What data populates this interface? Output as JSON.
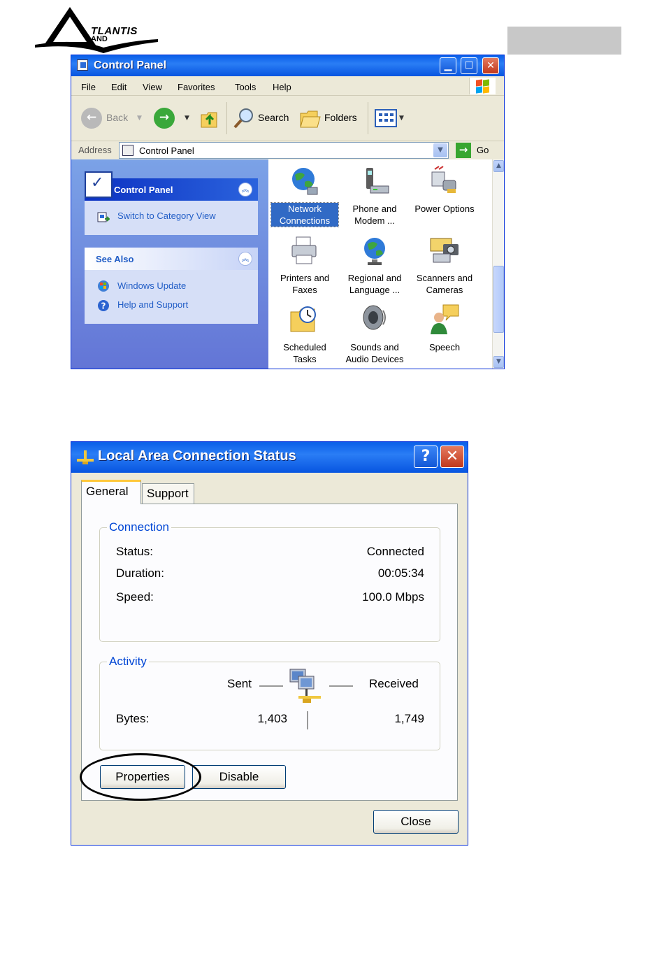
{
  "header": {
    "logo_text": "TLANTIS",
    "logo_sub": "AND"
  },
  "control_panel": {
    "title": "Control Panel",
    "menu": [
      "File",
      "Edit",
      "View",
      "Favorites",
      "Tools",
      "Help"
    ],
    "toolbar": {
      "back_label": "Back",
      "search_label": "Search",
      "folders_label": "Folders"
    },
    "address": {
      "label": "Address",
      "value": "Control Panel",
      "go_label": "Go"
    },
    "task_panel": {
      "title": "Control Panel",
      "switch_link": "Switch to Category View"
    },
    "see_also": {
      "title": "See Also",
      "links": [
        "Windows Update",
        "Help and Support"
      ]
    },
    "items": [
      {
        "label": "Network Connections",
        "icon": "network-globe-icon",
        "selected": true
      },
      {
        "label": "Phone and Modem ...",
        "icon": "phone-modem-icon",
        "selected": false
      },
      {
        "label": "Power Options",
        "icon": "power-plug-icon",
        "selected": false
      },
      {
        "label": "Printers and Faxes",
        "icon": "printer-icon",
        "selected": false
      },
      {
        "label": "Regional and Language ...",
        "icon": "globe-icon",
        "selected": false
      },
      {
        "label": "Scanners and Cameras",
        "icon": "scanner-camera-icon",
        "selected": false
      },
      {
        "label": "Scheduled Tasks",
        "icon": "scheduled-folder-icon",
        "selected": false
      },
      {
        "label": "Sounds and Audio Devices",
        "icon": "speaker-icon",
        "selected": false
      },
      {
        "label": "Speech",
        "icon": "speech-icon",
        "selected": false
      }
    ]
  },
  "status_dialog": {
    "title": "Local Area Connection Status",
    "help_glyph": "?",
    "close_glyph": "✕",
    "tabs": [
      "General",
      "Support"
    ],
    "connection": {
      "group_title": "Connection",
      "status_label": "Status:",
      "status_value": "Connected",
      "duration_label": "Duration:",
      "duration_value": "00:05:34",
      "speed_label": "Speed:",
      "speed_value": "100.0 Mbps"
    },
    "activity": {
      "group_title": "Activity",
      "sent_label": "Sent",
      "received_label": "Received",
      "bytes_label": "Bytes:",
      "bytes_sent": "1,403",
      "bytes_received": "1,749"
    },
    "buttons": {
      "properties": "Properties",
      "disable": "Disable",
      "close": "Close"
    }
  },
  "colors": {
    "xp_title_blue": "#0a5ee8",
    "selection_blue": "#316ac5",
    "group_title_blue": "#0046d5",
    "close_red": "#c1381c"
  }
}
